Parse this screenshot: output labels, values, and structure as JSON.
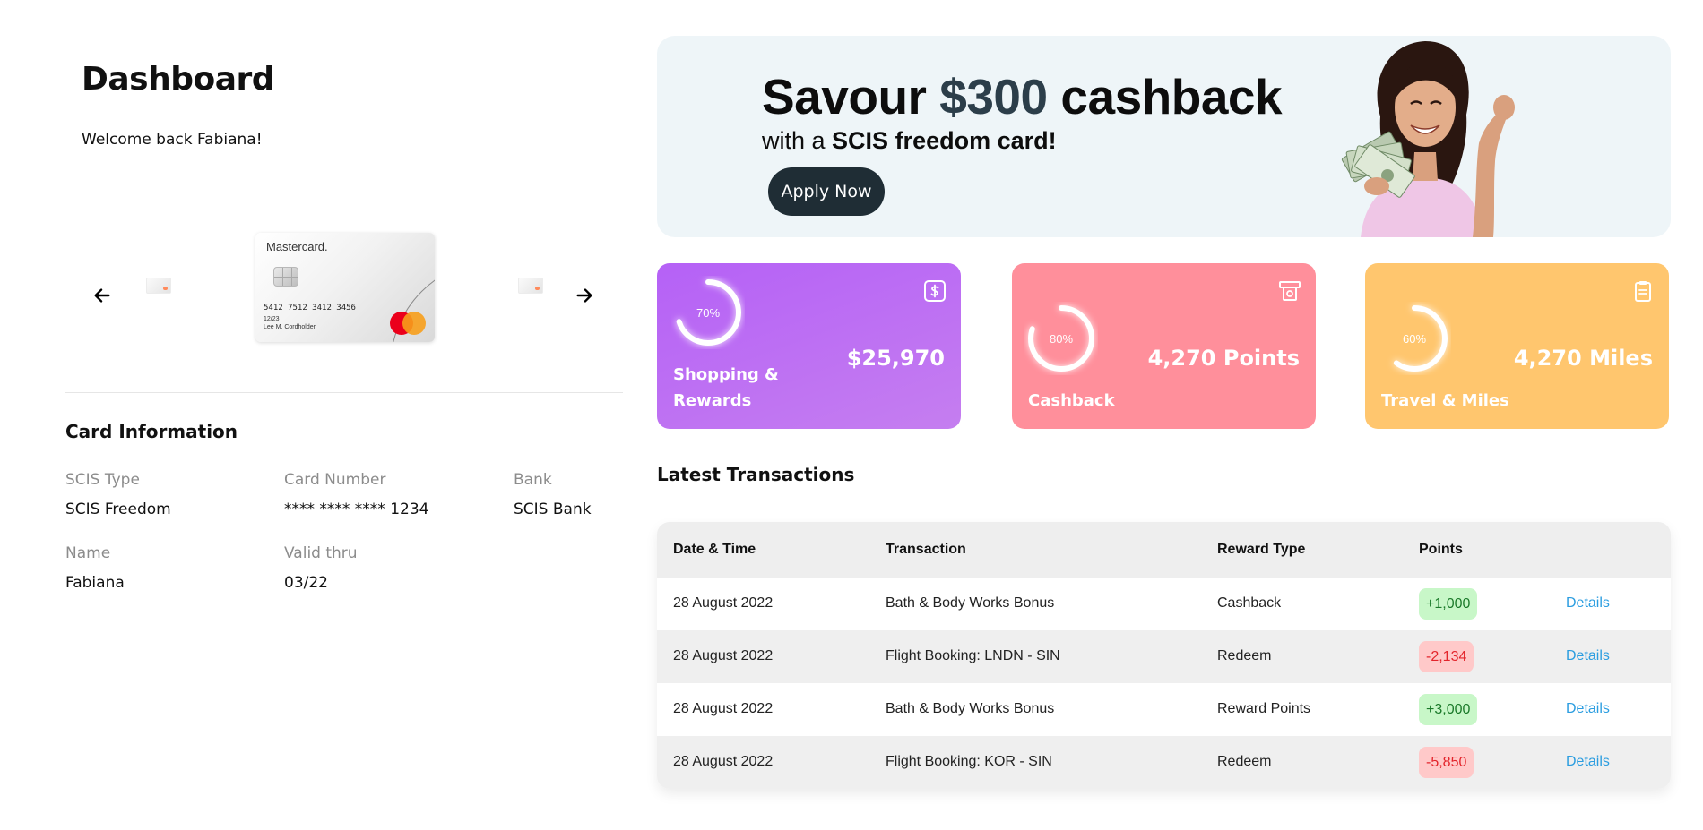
{
  "header": {
    "title": "Dashboard",
    "welcome": "Welcome back Fabiana!"
  },
  "carousel": {
    "card": {
      "brand": "Mastercard.",
      "number": "5412 7512 3412 3456",
      "expiry": "12/23",
      "holder": "Lee M. Cordholder"
    }
  },
  "card_info": {
    "title": "Card Information",
    "fields": [
      {
        "label": "SCIS Type",
        "value": "SCIS Freedom"
      },
      {
        "label": "Card Number",
        "value": "**** **** **** 1234"
      },
      {
        "label": "Bank",
        "value": "SCIS Bank"
      },
      {
        "label": "Name",
        "value": "Fabiana"
      },
      {
        "label": "Valid thru",
        "value": "03/22"
      }
    ]
  },
  "banner": {
    "headline_pre": "Savour ",
    "headline_amount": "$300",
    "headline_post": " cashback",
    "sub_pre": "with a ",
    "sub_bold": "SCIS freedom card!",
    "cta": "Apply Now"
  },
  "stats": [
    {
      "name_line1": "Shopping &",
      "name_line2": "Rewards",
      "value": "$25,970",
      "progress": 70,
      "progress_label": "70%",
      "icon": "dollar-icon",
      "color": "#b561f6"
    },
    {
      "name_line1": "Cashback",
      "name_line2": "",
      "value": "4,270 Points",
      "progress": 80,
      "progress_label": "80%",
      "icon": "atm-cash-icon",
      "color": "#ff8f9b"
    },
    {
      "name_line1": "Travel & Miles",
      "name_line2": "",
      "value": "4,270 Miles",
      "progress": 60,
      "progress_label": "60%",
      "icon": "clipboard-icon",
      "color": "#ffc66e"
    }
  ],
  "transactions": {
    "title": "Latest Transactions",
    "columns": [
      "Date & Time",
      "Transaction",
      "Reward Type",
      "Points"
    ],
    "rows": [
      {
        "date": "28 August 2022",
        "transaction": "Bath & Body Works Bonus",
        "reward_type": "Cashback",
        "points": "+1,000",
        "sign": "pos",
        "action": "Details"
      },
      {
        "date": "28 August 2022",
        "transaction": "Flight Booking: LNDN - SIN",
        "reward_type": "Redeem",
        "points": "-2,134",
        "sign": "neg",
        "action": "Details"
      },
      {
        "date": "28 August 2022",
        "transaction": "Bath & Body Works Bonus",
        "reward_type": "Reward Points",
        "points": "+3,000",
        "sign": "pos",
        "action": "Details"
      },
      {
        "date": "28 August 2022",
        "transaction": "Flight Booking: KOR - SIN",
        "reward_type": "Redeem",
        "points": "-5,850",
        "sign": "neg",
        "action": "Details"
      }
    ]
  },
  "colors": {
    "positive": "#1b7a2a",
    "negative": "#e3242b",
    "link": "#2b9de0",
    "cta_bg": "#1f2d35"
  }
}
